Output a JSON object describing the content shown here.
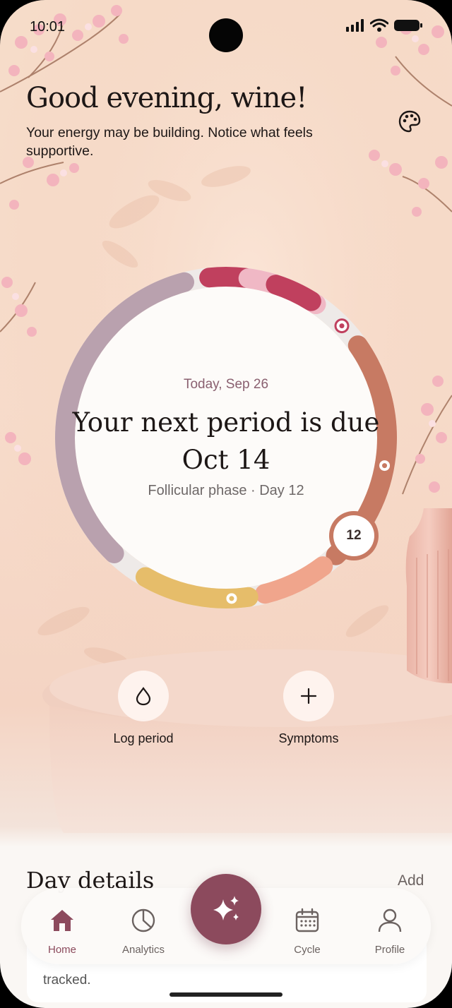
{
  "status_bar": {
    "time": "10:01"
  },
  "header": {
    "greeting": "Good evening, wine!",
    "subtitle": "Your energy may be building. Notice what feels supportive."
  },
  "cycle": {
    "today_label": "Today, Sep 26",
    "headline": "Your next period is due Oct 14",
    "phase_label": "Follicular phase · Day 12",
    "current_day": "12",
    "colors": {
      "period": "#c0405e",
      "period_light": "#f0b8c5",
      "follicular": "#c77a63",
      "ovulation": "#f0a58c",
      "fertile": "#e6bd6a",
      "luteal": "#b9a1ae",
      "track": "#eeeae8"
    }
  },
  "actions": [
    {
      "label": "Log period",
      "icon": "drop-icon"
    },
    {
      "label": "Symptoms",
      "icon": "plus-icon"
    }
  ],
  "day_details": {
    "title": "Day details",
    "add_label": "Add",
    "card_text": "tracked."
  },
  "nav": {
    "items": [
      {
        "label": "Home",
        "icon": "home-icon",
        "active": true
      },
      {
        "label": "Analytics",
        "icon": "pie-chart-icon",
        "active": false
      },
      {
        "label": "Cycle",
        "icon": "calendar-icon",
        "active": false
      },
      {
        "label": "Profile",
        "icon": "profile-icon",
        "active": false
      }
    ],
    "fab_icon": "sparkles-icon",
    "accent": "#8c4a5d"
  }
}
